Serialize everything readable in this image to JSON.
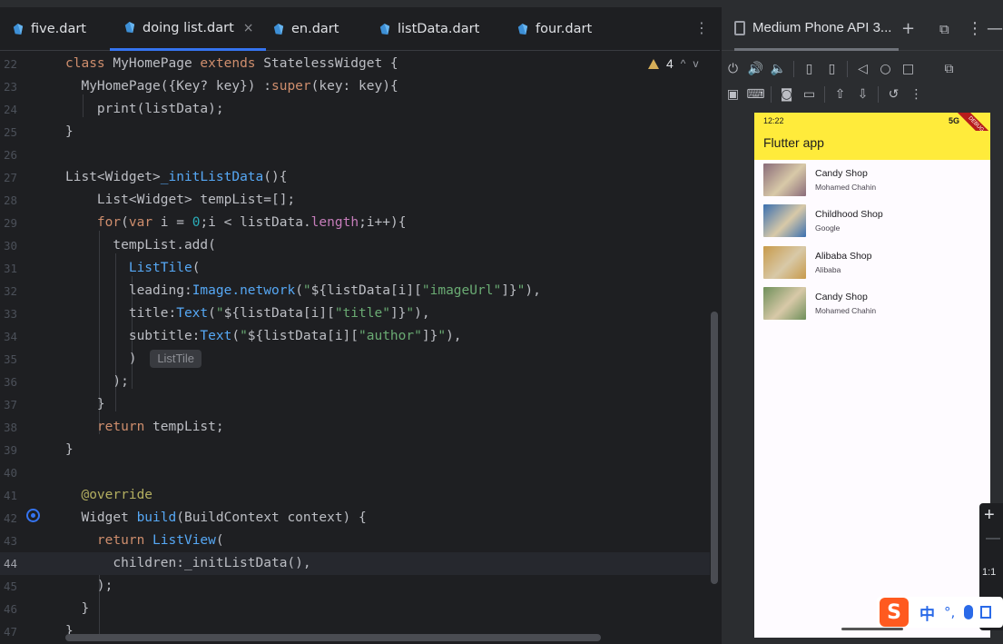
{
  "editor": {
    "tabs": [
      {
        "label": "five.dart"
      },
      {
        "label": "doing list.dart",
        "active": true,
        "close": "×"
      },
      {
        "label": "en.dart"
      },
      {
        "label": "listData.dart"
      },
      {
        "label": "four.dart"
      }
    ],
    "tabs_menu": "⋮",
    "inspection": {
      "count": "4",
      "up": "^",
      "down": "v"
    },
    "lines": [
      {
        "n": "22",
        "html": "<span class=\"kw\">class</span> MyHomePage <span class=\"kw\">extends</span> StatelessWidget {"
      },
      {
        "n": "23",
        "html": "  MyHomePage({Key? key}) :<span class=\"kw\">super</span>(key: key){"
      },
      {
        "n": "24",
        "html": "    print(listData);"
      },
      {
        "n": "25",
        "html": "}"
      },
      {
        "n": "26",
        "html": ""
      },
      {
        "n": "27",
        "html": "List&lt;Widget&gt;<span class=\"fn\">_initListData</span>(){"
      },
      {
        "n": "28",
        "html": "    List&lt;Widget&gt; tempList=[];"
      },
      {
        "n": "29",
        "html": "    <span class=\"kw\">for</span>(<span class=\"kw\">var</span> i = <span class=\"num\">0</span>;i &lt; listData.<span class=\"prop\">length</span>;i++){"
      },
      {
        "n": "30",
        "html": "      tempList.add("
      },
      {
        "n": "31",
        "html": "        <span class=\"fn\">ListTile</span>("
      },
      {
        "n": "32",
        "html": "        leading:<span class=\"fn\">Image.network</span>(<span class=\"str\">\"</span>${listData[i][<span class=\"str\">\"imageUrl\"</span>]}<span class=\"str\">\"</span>),"
      },
      {
        "n": "33",
        "html": "        title:<span class=\"fn\">Text</span>(<span class=\"str\">\"</span>${listData[i][<span class=\"str\">\"title\"</span>]}<span class=\"str\">\"</span>),"
      },
      {
        "n": "34",
        "html": "        subtitle:<span class=\"fn\">Text</span>(<span class=\"str\">\"</span>${listData[i][<span class=\"str\">\"author\"</span>]}<span class=\"str\">\"</span>),"
      },
      {
        "n": "35",
        "html": "        ) <span class=\"hint\">ListTile</span>"
      },
      {
        "n": "36",
        "html": "      );"
      },
      {
        "n": "37",
        "html": "    }"
      },
      {
        "n": "38",
        "html": "    <span class=\"kw\">return</span> tempList;"
      },
      {
        "n": "39",
        "html": "}"
      },
      {
        "n": "40",
        "html": ""
      },
      {
        "n": "41",
        "html": "  <span class=\"ann\">@override</span>"
      },
      {
        "n": "42",
        "html": "  Widget <span class=\"fn\">build</span>(BuildContext context) {"
      },
      {
        "n": "43",
        "html": "    <span class=\"kw\">return</span> <span class=\"fn\">ListView</span>("
      },
      {
        "n": "44",
        "html": "      children:_initListData(),",
        "current": true
      },
      {
        "n": "45",
        "html": "    );"
      },
      {
        "n": "46",
        "html": "  }"
      },
      {
        "n": "47",
        "html": "}"
      }
    ]
  },
  "panel": {
    "device_tab": "Medium Phone API 3...",
    "add_icon": "+",
    "more_icon": "⋮",
    "minimize_icon": "—"
  },
  "phone": {
    "time": "12:22",
    "signal": "5G",
    "debug_banner": "DEBUG",
    "app_title": "Flutter app",
    "items": [
      {
        "title": "Candy Shop",
        "subtitle": "Mohamed Chahin",
        "thumb_color": "#8a6b7a"
      },
      {
        "title": "Childhood Shop",
        "subtitle": "Google",
        "thumb_color": "#3a6fb0"
      },
      {
        "title": "Alibaba Shop",
        "subtitle": "Alibaba",
        "thumb_color": "#c89a4a"
      },
      {
        "title": "Candy Shop",
        "subtitle": "Mohamed Chahin",
        "thumb_color": "#6e8f5a"
      }
    ]
  },
  "zoom": {
    "plus": "+",
    "minus": "—",
    "ratio": "1:1"
  },
  "ime": {
    "logo": "S",
    "lang": "中",
    "punct": "°,"
  }
}
